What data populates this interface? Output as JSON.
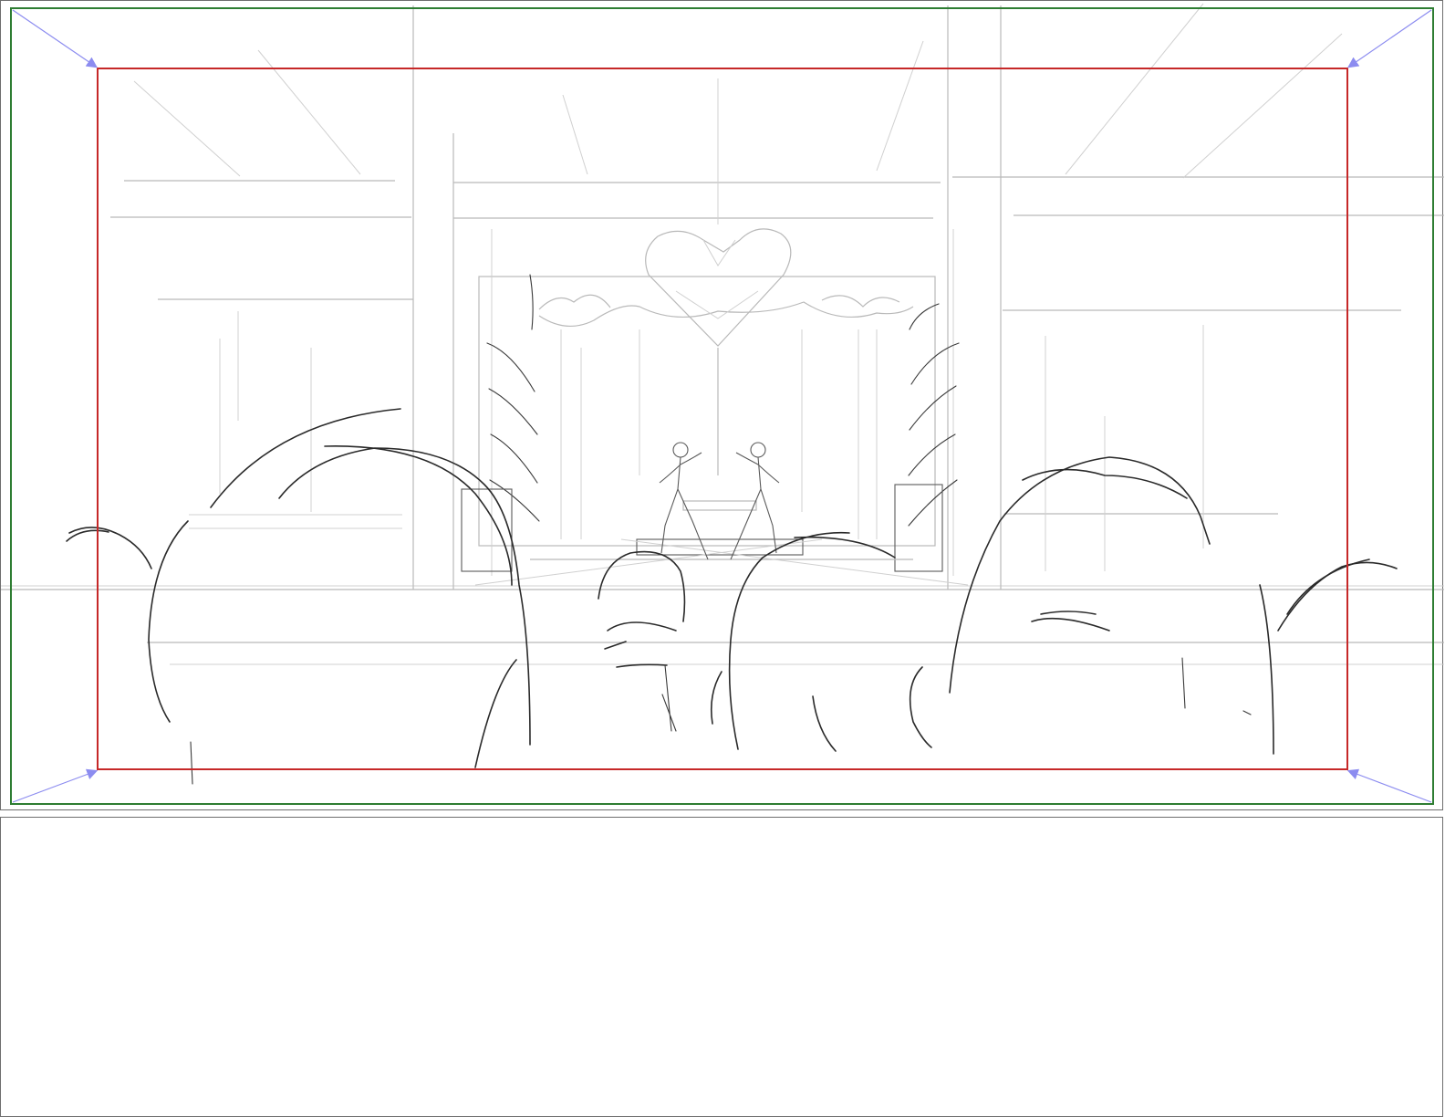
{
  "storyboard": {
    "panel_count": 2,
    "frames": {
      "outer_frame_color": "#2e7d32",
      "safe_frame_color": "#c62828",
      "corner_arrow_color": "#8c8cf0"
    },
    "sketch_subject": "",
    "notes_panel": {
      "text": ""
    }
  }
}
